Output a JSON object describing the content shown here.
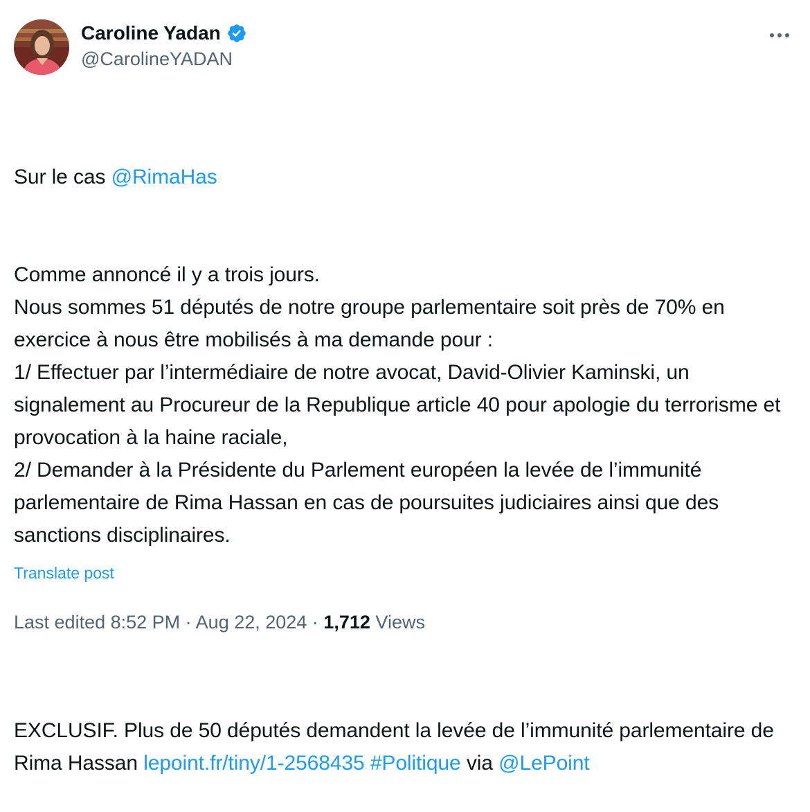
{
  "author": {
    "display_name": "Caroline Yadan",
    "handle": "@CarolineYADAN",
    "verified_icon": "verified-badge-icon"
  },
  "more_icon": "more-options-icon",
  "tweet": {
    "line1_prefix": "Sur le cas ",
    "line1_mention": "@RimaHas",
    "body": "Comme annoncé il y a trois jours.\nNous sommes 51 députés de notre groupe parlementaire soit près de 70% en exercice à nous être mobilisés à ma demande pour :\n1/ Effectuer par l’intermédiaire de notre avocat, David-Olivier Kaminski, un signalement au Procureur de la Republique article 40 pour apologie du terrorisme et provocation à la haine raciale,\n2/ Demander à la Présidente du Parlement européen la levée de l’immunité parlementaire de Rima Hassan en cas de poursuites judiciaires ainsi que des sanctions disciplinaires.",
    "exclusive_text": "EXCLUSIF. Plus de 50 députés demandent la levée de l’immunité parlementaire de Rima Hassan ",
    "link": "lepoint.fr/tiny/1-2568435",
    "hashtag": "#Politique",
    "via": " via ",
    "via_mention": "@LePoint"
  },
  "translate_label": "Translate post",
  "meta": {
    "edited_label": "Last edited 8:52 PM",
    "separator": " · ",
    "date": "Aug 22, 2024",
    "views_count": "1,712",
    "views_label": "Views"
  },
  "colors": {
    "link": "#1d9bf0",
    "text": "#0f1419",
    "secondary": "#536471"
  }
}
